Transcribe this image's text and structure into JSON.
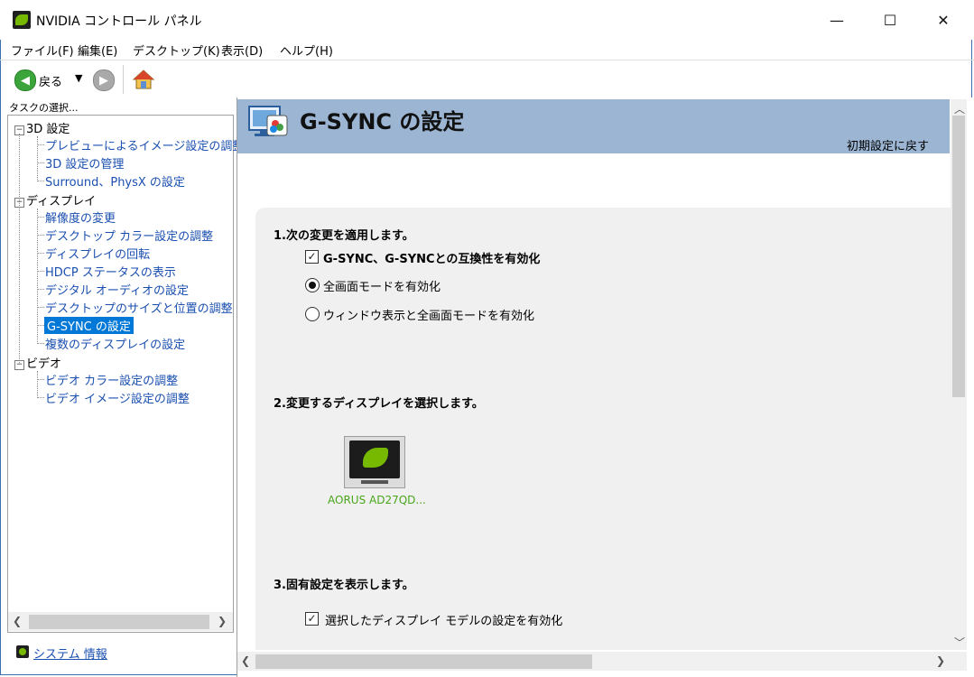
{
  "window": {
    "title": "NVIDIA コントロール パネル",
    "minimize_glyph": "—",
    "maximize_glyph": "☐",
    "close_glyph": "✕"
  },
  "menu": [
    "ファイル(F)",
    "編集(E)",
    "デスクトップ(K)",
    "表示(D)",
    "ヘルプ(H)"
  ],
  "toolbar": {
    "back_label": "戻る",
    "back_icon": "back-arrow-icon",
    "dropdown_icon": "caret-down-icon",
    "forward_icon": "forward-arrow-icon",
    "home_icon": "home-icon"
  },
  "sidebar": {
    "task_label": "タスクの選択...",
    "categories": [
      {
        "label": "3D 設定",
        "items": [
          "プレビューによるイメージ設定の調整",
          "3D 設定の管理",
          "Surround、PhysX の設定"
        ]
      },
      {
        "label": "ディスプレイ",
        "items": [
          "解像度の変更",
          "デスクトップ カラー設定の調整",
          "ディスプレイの回転",
          "HDCP ステータスの表示",
          "デジタル オーディオの設定",
          "デスクトップのサイズと位置の調整",
          "G-SYNC の設定",
          "複数のディスプレイの設定"
        ]
      },
      {
        "label": "ビデオ",
        "items": [
          "ビデオ カラー設定の調整",
          "ビデオ イメージ設定の調整"
        ]
      }
    ],
    "selected_item": "G-SYNC の設定",
    "system_info_label": "システム 情報"
  },
  "main": {
    "title": "G-SYNC の設定",
    "restore_defaults": "初期設定に戻す",
    "step1": {
      "heading": "1.次の変更を適用します。",
      "checkbox_label": "G-SYNC、G-SYNCとの互換性を有効化",
      "checkbox_checked": true,
      "radio_options": [
        "全画面モードを有効化",
        "ウィンドウ表示と全画面モードを有効化"
      ],
      "radio_selected": 0
    },
    "step2": {
      "heading": "2.変更するディスプレイを選択します。",
      "display_name": "AORUS AD27QD..."
    },
    "step3": {
      "heading": "3.固有設定を表示します。",
      "checkbox_label": "選択したディスプレイ モデルの設定を有効化",
      "checkbox_checked": true
    }
  },
  "colors": {
    "accent": "#0078d7",
    "header_band": "#9bb5d3",
    "nvidia_green": "#76b900",
    "link_blue": "#1a4fb0",
    "display_label": "#49a61a"
  }
}
